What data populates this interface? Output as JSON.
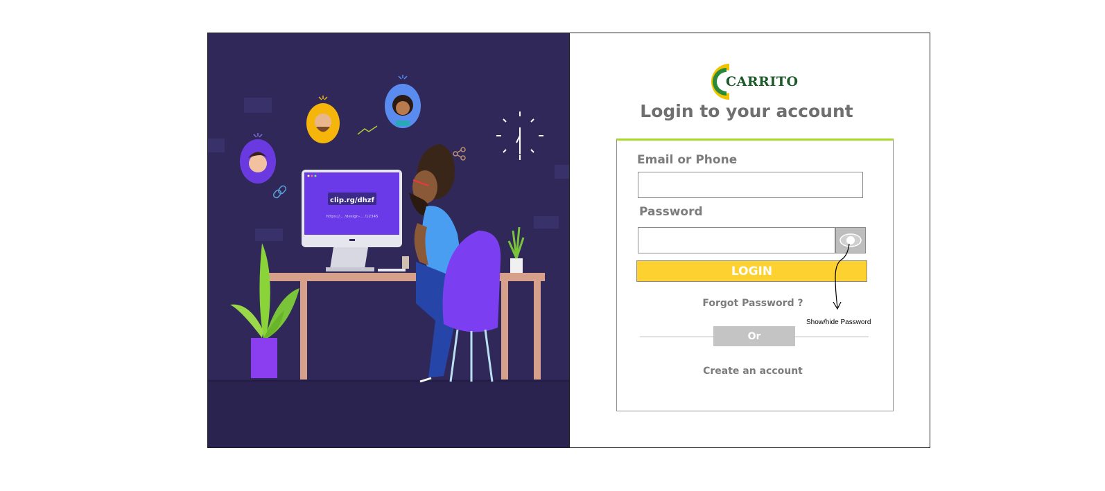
{
  "illustration": {
    "screen_label": "clip.rg/dhzf",
    "screen_sublabel": "https://... /design-... /12345"
  },
  "logo": {
    "text": "CARRITO"
  },
  "heading": "Login to your account",
  "form": {
    "email_label": "Email or Phone",
    "email_value": "",
    "password_label": "Password",
    "password_value": "",
    "login_label": "LOGIN",
    "forgot_label": "Forgot Password ?",
    "or_label": "Or",
    "create_label": "Create an account"
  },
  "annotation": {
    "text": "Show/hide Password"
  },
  "colors": {
    "panel_bg": "#2f2858",
    "accent_green": "#a8d92b",
    "login_yellow": "#fcd130",
    "or_grey": "#c4c4c4",
    "text_grey": "#7c7c7c"
  },
  "icons": [
    "eye-icon",
    "carrito-logo",
    "clock-icon",
    "share-icon",
    "link-icon",
    "trend-icon"
  ]
}
